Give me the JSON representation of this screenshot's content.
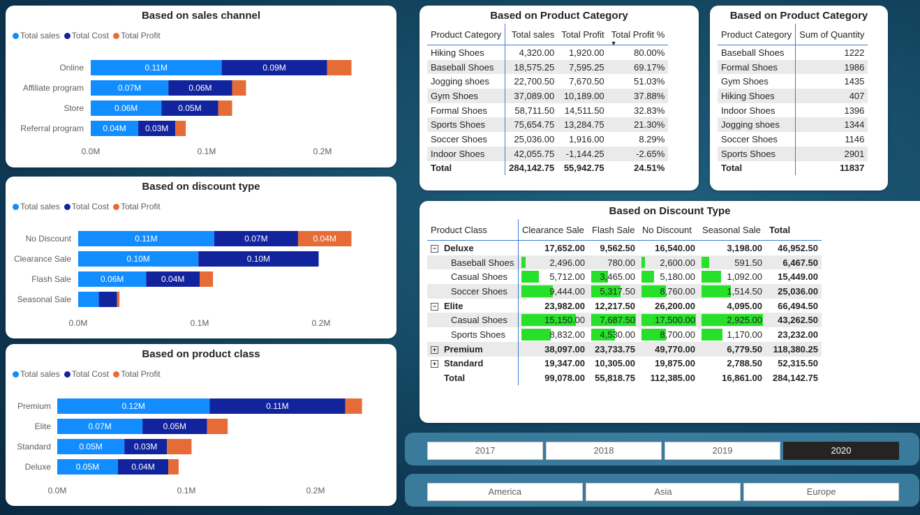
{
  "colors": {
    "sales": "#118dff",
    "cost": "#12239e",
    "profit": "#e66c37",
    "databar": "#27e02a"
  },
  "legend": [
    "Total sales",
    "Total Cost",
    "Total Profit"
  ],
  "charts": [
    {
      "title": "Based on sales channel",
      "categories": [
        "Online",
        "Affiliate program",
        "Store",
        "Referral program"
      ],
      "sales_labels": [
        "0.11M",
        "0.07M",
        "0.06M",
        "0.04M"
      ],
      "cost_labels": [
        "0.09M",
        "0.06M",
        "0.05M",
        "0.03M"
      ],
      "profit_labels": [
        "",
        "",
        "",
        ""
      ],
      "ticks": [
        "0.0M",
        "0.1M",
        "0.2M"
      ]
    },
    {
      "title": "Based on discount type",
      "categories": [
        "No Discount",
        "Clearance Sale",
        "Flash Sale",
        "Seasonal Sale"
      ],
      "sales_labels": [
        "0.11M",
        "0.10M",
        "0.06M",
        ""
      ],
      "cost_labels": [
        "0.07M",
        "0.10M",
        "0.04M",
        ""
      ],
      "profit_labels": [
        "0.04M",
        "",
        "",
        ""
      ],
      "ticks": [
        "0.0M",
        "0.1M",
        "0.2M"
      ]
    },
    {
      "title": "Based on product class",
      "categories": [
        "Premium",
        "Elite",
        "Standard",
        "Deluxe"
      ],
      "sales_labels": [
        "0.12M",
        "0.07M",
        "0.05M",
        "0.05M"
      ],
      "cost_labels": [
        "0.11M",
        "0.05M",
        "0.03M",
        "0.04M"
      ],
      "profit_labels": [
        "",
        "",
        "",
        ""
      ],
      "ticks": [
        "0.0M",
        "0.1M",
        "0.2M"
      ]
    }
  ],
  "chart_data": [
    {
      "type": "bar",
      "orientation": "horizontal",
      "stacked": true,
      "title": "Based on sales channel",
      "categories": [
        "Online",
        "Affiliate program",
        "Store",
        "Referral program"
      ],
      "series": [
        {
          "name": "Total sales",
          "values": [
            0.113,
            0.067,
            0.061,
            0.041
          ]
        },
        {
          "name": "Total Cost",
          "values": [
            0.091,
            0.055,
            0.049,
            0.032
          ]
        },
        {
          "name": "Total Profit",
          "values": [
            0.021,
            0.012,
            0.012,
            0.009
          ]
        }
      ],
      "xlim": [
        0,
        0.24
      ],
      "legend": "top-left"
    },
    {
      "type": "bar",
      "orientation": "horizontal",
      "stacked": true,
      "title": "Based on discount type",
      "categories": [
        "No Discount",
        "Clearance Sale",
        "Flash Sale",
        "Seasonal Sale"
      ],
      "series": [
        {
          "name": "Total sales",
          "values": [
            0.112,
            0.099,
            0.056,
            0.017
          ]
        },
        {
          "name": "Total Cost",
          "values": [
            0.069,
            0.099,
            0.044,
            0.015
          ]
        },
        {
          "name": "Total Profit",
          "values": [
            0.044,
            0.0,
            0.011,
            0.002
          ]
        }
      ],
      "xlim": [
        0,
        0.24
      ],
      "legend": "top-left"
    },
    {
      "type": "bar",
      "orientation": "horizontal",
      "stacked": true,
      "title": "Based on product class",
      "categories": [
        "Premium",
        "Elite",
        "Standard",
        "Deluxe"
      ],
      "series": [
        {
          "name": "Total sales",
          "values": [
            0.118,
            0.066,
            0.052,
            0.047
          ]
        },
        {
          "name": "Total Cost",
          "values": [
            0.105,
            0.05,
            0.033,
            0.039
          ]
        },
        {
          "name": "Total Profit",
          "values": [
            0.013,
            0.016,
            0.019,
            0.008
          ]
        }
      ],
      "xlim": [
        0,
        0.24
      ],
      "legend": "top-left"
    }
  ],
  "category_table": {
    "title": "Based on Product Category",
    "headers": [
      "Product Category",
      "Total sales",
      "Total Profit",
      "Total Profit %"
    ],
    "sort_icon": "sort-down-icon",
    "rows": [
      [
        "Hiking Shoes",
        "4,320.00",
        "1,920.00",
        "80.00%"
      ],
      [
        "Baseball Shoes",
        "18,575.25",
        "7,595.25",
        "69.17%"
      ],
      [
        "Jogging shoes",
        "22,700.50",
        "7,670.50",
        "51.03%"
      ],
      [
        "Gym Shoes",
        "37,089.00",
        "10,189.00",
        "37.88%"
      ],
      [
        "Formal Shoes",
        "58,711.50",
        "14,511.50",
        "32.83%"
      ],
      [
        "Sports Shoes",
        "75,654.75",
        "13,284.75",
        "21.30%"
      ],
      [
        "Soccer Shoes",
        "25,036.00",
        "1,916.00",
        "8.29%"
      ],
      [
        "Indoor Shoes",
        "42,055.75",
        "-1,144.25",
        "-2.65%"
      ]
    ],
    "total": [
      "Total",
      "284,142.75",
      "55,942.75",
      "24.51%"
    ]
  },
  "quantity_table": {
    "title": "Based on Product Category",
    "headers": [
      "Product Category",
      "Sum of Quantity"
    ],
    "rows": [
      [
        "Baseball Shoes",
        "1222"
      ],
      [
        "Formal Shoes",
        "1986"
      ],
      [
        "Gym Shoes",
        "1435"
      ],
      [
        "Hiking Shoes",
        "407"
      ],
      [
        "Indoor Shoes",
        "1396"
      ],
      [
        "Jogging shoes",
        "1344"
      ],
      [
        "Soccer Shoes",
        "1146"
      ],
      [
        "Sports Shoes",
        "2901"
      ]
    ],
    "total": [
      "Total",
      "11837"
    ]
  },
  "discount_matrix": {
    "title": "Based on Discount Type",
    "headers": [
      "Product Class",
      "Clearance Sale",
      "Flash Sale",
      "No Discount",
      "Seasonal Sale",
      "Total"
    ],
    "rows": [
      {
        "level": 1,
        "toggle": "⊟",
        "label": "Deluxe",
        "values": [
          "17,652.00",
          "9,562.50",
          "16,540.00",
          "3,198.00",
          "46,952.50"
        ],
        "fill": [
          null,
          null,
          null,
          null
        ]
      },
      {
        "level": 2,
        "toggle": "",
        "label": "Baseball Shoes",
        "values": [
          "2,496.00",
          "780.00",
          "2,600.00",
          "591.50",
          "6,467.50"
        ],
        "fill": [
          0.14,
          0.1,
          0.15,
          0.2
        ]
      },
      {
        "level": 2,
        "toggle": "",
        "label": "Casual Shoes",
        "values": [
          "5,712.00",
          "3,465.00",
          "5,180.00",
          "1,092.00",
          "15,449.00"
        ],
        "fill": [
          0.33,
          0.45,
          0.3,
          0.37
        ]
      },
      {
        "level": 2,
        "toggle": "",
        "label": "Soccer Shoes",
        "values": [
          "9,444.00",
          "5,317.50",
          "8,760.00",
          "1,514.50",
          "25,036.00"
        ],
        "fill": [
          0.53,
          0.69,
          0.5,
          0.52
        ]
      },
      {
        "level": 1,
        "toggle": "⊟",
        "label": "Elite",
        "values": [
          "23,982.00",
          "12,217.50",
          "26,200.00",
          "4,095.00",
          "66,494.50"
        ],
        "fill": [
          null,
          null,
          null,
          null
        ]
      },
      {
        "level": 2,
        "toggle": "",
        "label": "Casual Shoes",
        "values": [
          "15,150.00",
          "7,687.50",
          "17,500.00",
          "2,925.00",
          "43,262.50"
        ],
        "fill": [
          0.86,
          1.0,
          1.0,
          1.0
        ]
      },
      {
        "level": 2,
        "toggle": "",
        "label": "Sports Shoes",
        "values": [
          "8,832.00",
          "4,530.00",
          "8,700.00",
          "1,170.00",
          "23,232.00"
        ],
        "fill": [
          0.5,
          0.59,
          0.5,
          0.4
        ]
      },
      {
        "level": 1,
        "toggle": "⊞",
        "label": "Premium",
        "values": [
          "38,097.00",
          "23,733.75",
          "49,770.00",
          "6,779.50",
          "118,380.25"
        ],
        "fill": [
          null,
          null,
          null,
          null
        ]
      },
      {
        "level": 1,
        "toggle": "⊞",
        "label": "Standard",
        "values": [
          "19,347.00",
          "10,305.00",
          "19,875.00",
          "2,788.50",
          "52,315.50"
        ],
        "fill": [
          null,
          null,
          null,
          null
        ]
      },
      {
        "level": 1,
        "toggle": "",
        "label": "Total",
        "values": [
          "99,078.00",
          "55,818.75",
          "112,385.00",
          "16,861.00",
          "284,142.75"
        ],
        "fill": [
          null,
          null,
          null,
          null
        ]
      }
    ]
  },
  "year_slicer": {
    "options": [
      "2017",
      "2018",
      "2019",
      "2020"
    ],
    "selected": "2020"
  },
  "region_slicer": {
    "options": [
      "America",
      "Asia",
      "Europe"
    ],
    "selected": ""
  }
}
